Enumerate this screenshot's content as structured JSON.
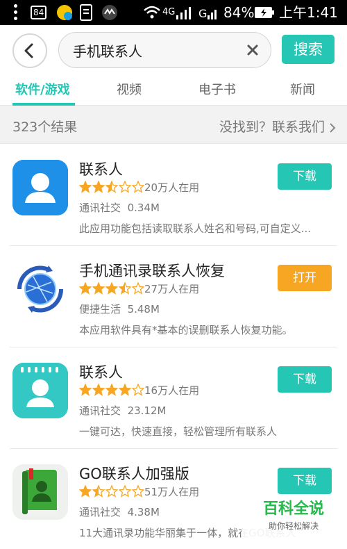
{
  "status_bar": {
    "signal_badge": "84",
    "network_label": "4G",
    "battery_percent": "84%",
    "time": "上午1:41"
  },
  "search": {
    "query": "手机联系人",
    "search_label": "搜索"
  },
  "tabs": [
    {
      "label": "软件/游戏",
      "active": true
    },
    {
      "label": "视频"
    },
    {
      "label": "电子书"
    },
    {
      "label": "新闻"
    }
  ],
  "results": {
    "count_text": "323个结果",
    "contact_link": "没找到？联系我们"
  },
  "apps": [
    {
      "name": "联系人",
      "rating": 2.5,
      "users": "20万人在用",
      "category": "通讯社交",
      "size": "0.34M",
      "description": "此应用功能包括读取联系人姓名和号码,可自定义...",
      "action": "下载",
      "action_color": "#25c6b4",
      "icon": "contacts-blue-icon"
    },
    {
      "name": "手机通讯录联系人恢复",
      "rating": 3.5,
      "users": "27万人在用",
      "category": "便捷生活",
      "size": "5.48M",
      "description": "本应用软件具有*基本的误删联系人恢复功能。",
      "action": "打开",
      "action_color": "#f7a623",
      "icon": "globe-restore-icon"
    },
    {
      "name": "联系人",
      "rating": 4,
      "users": "16万人在用",
      "category": "通讯社交",
      "size": "23.12M",
      "description": "一键可达，快速直接，轻松管理所有联系人",
      "action": "下载",
      "action_color": "#25c6b4",
      "icon": "contacts-teal-icon"
    },
    {
      "name": "GO联系人加强版",
      "rating": 1.5,
      "users": "51万人在用",
      "category": "通讯社交",
      "size": "4.38M",
      "description": "11大通讯录功能华丽集于一体，就在GO联系人",
      "action": "下载",
      "action_color": "#25c6b4",
      "icon": "green-book-icon"
    }
  ],
  "watermark": {
    "title": "百科全说",
    "subtitle": "助你轻松解决"
  },
  "colors": {
    "accent": "#25c6b4",
    "star": "#f7a623",
    "open_button": "#f7a623"
  }
}
